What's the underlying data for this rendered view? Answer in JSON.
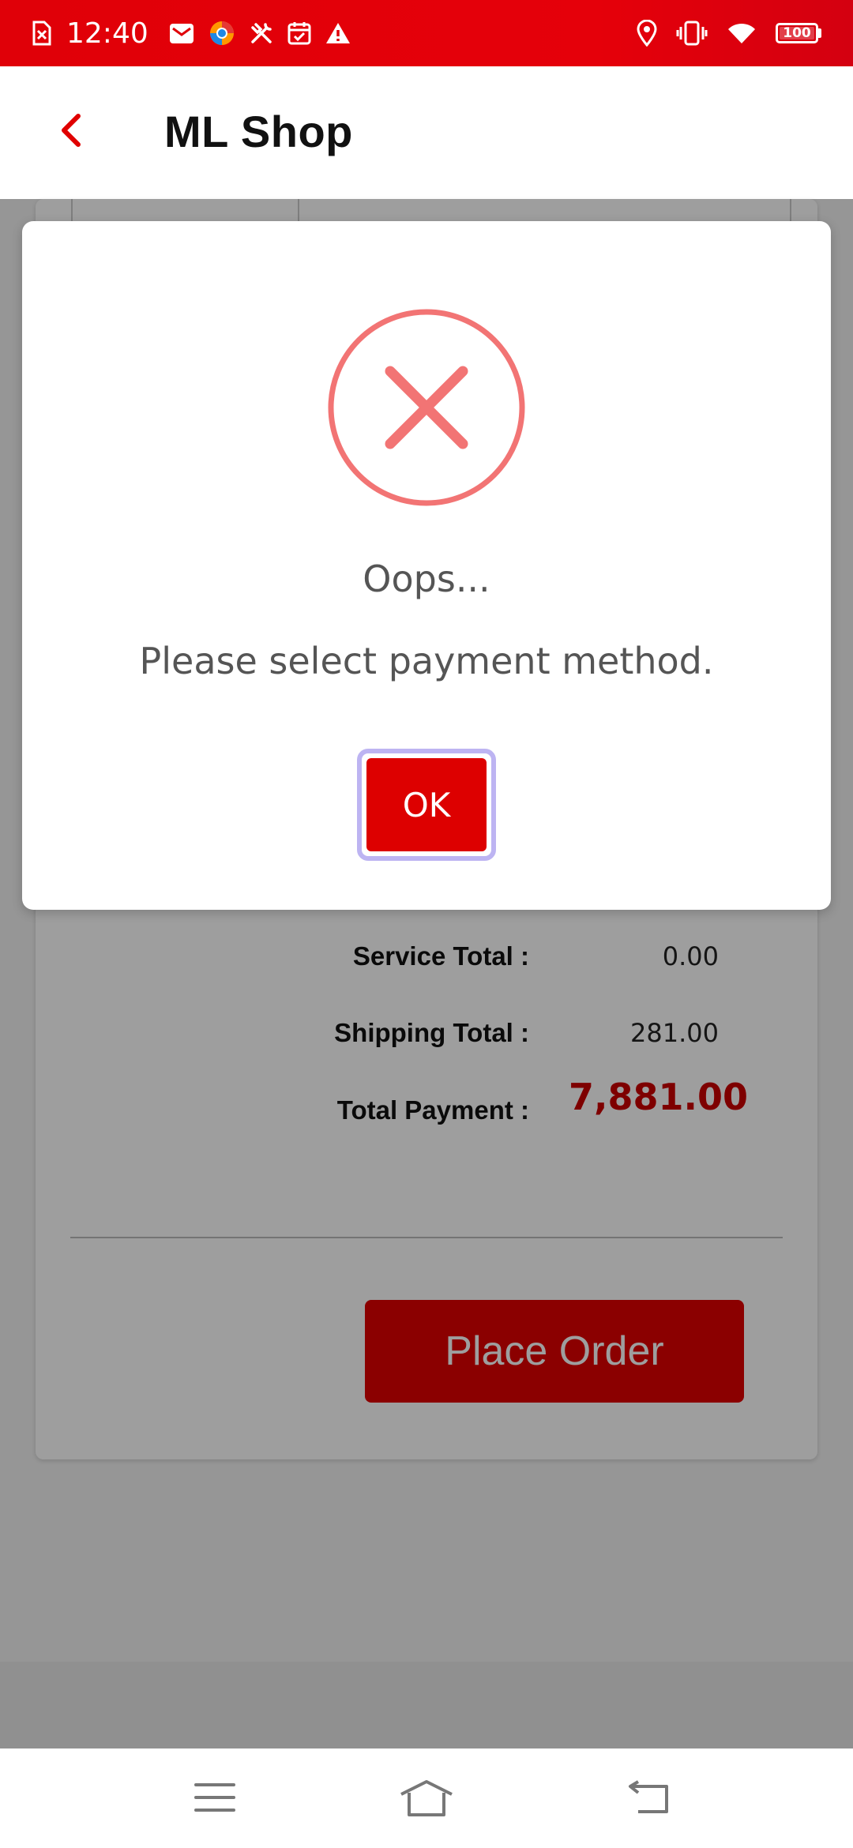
{
  "status_bar": {
    "time": "12:40",
    "battery": "100",
    "left_icons": [
      "sim-off-icon",
      "mail-icon",
      "browser-icon",
      "tools-icon",
      "calendar-icon",
      "warning-icon"
    ],
    "right_icons": [
      "location-icon",
      "vibrate-icon",
      "wifi-icon",
      "battery-icon"
    ]
  },
  "app_bar": {
    "title": "ML Shop",
    "back_icon": "chevron-left-icon",
    "accent_color": "#e00000"
  },
  "order_summary": {
    "service_total_label": "Service Total :",
    "service_total_value": "0.00",
    "shipping_total_label": "Shipping Total :",
    "shipping_total_value": "281.00",
    "total_payment_label": "Total Payment :",
    "total_payment_value": "7,881.00",
    "place_order_label": "Place Order"
  },
  "dialog": {
    "icon": "error-x-icon",
    "icon_color": "#f27474",
    "title": "Oops...",
    "message": "Please select payment method.",
    "ok_label": "OK"
  },
  "nav_bar": {
    "items": [
      "menu-icon",
      "home-icon",
      "back-icon"
    ]
  }
}
